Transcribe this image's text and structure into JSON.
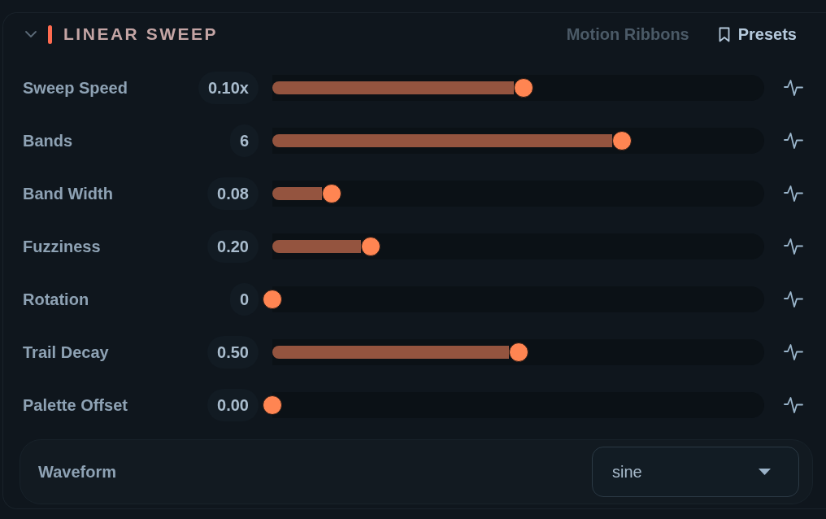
{
  "section": {
    "title": "LINEAR SWEEP",
    "expanded": true,
    "subtitle": "Motion Ribbons",
    "presets_label": "Presets"
  },
  "params": [
    {
      "label": "Sweep Speed",
      "value": "0.10x",
      "level": 0.51
    },
    {
      "label": "Bands",
      "value": "6",
      "level": 0.71
    },
    {
      "label": "Band Width",
      "value": "0.08",
      "level": 0.12
    },
    {
      "label": "Fuzziness",
      "value": "0.20",
      "level": 0.2
    },
    {
      "label": "Rotation",
      "value": "0",
      "level": 0
    },
    {
      "label": "Trail Decay",
      "value": "0.50",
      "level": 0.5
    },
    {
      "label": "Palette Offset",
      "value": "0.00",
      "level": 0
    }
  ],
  "waveform": {
    "label": "Waveform",
    "value": "sine"
  }
}
